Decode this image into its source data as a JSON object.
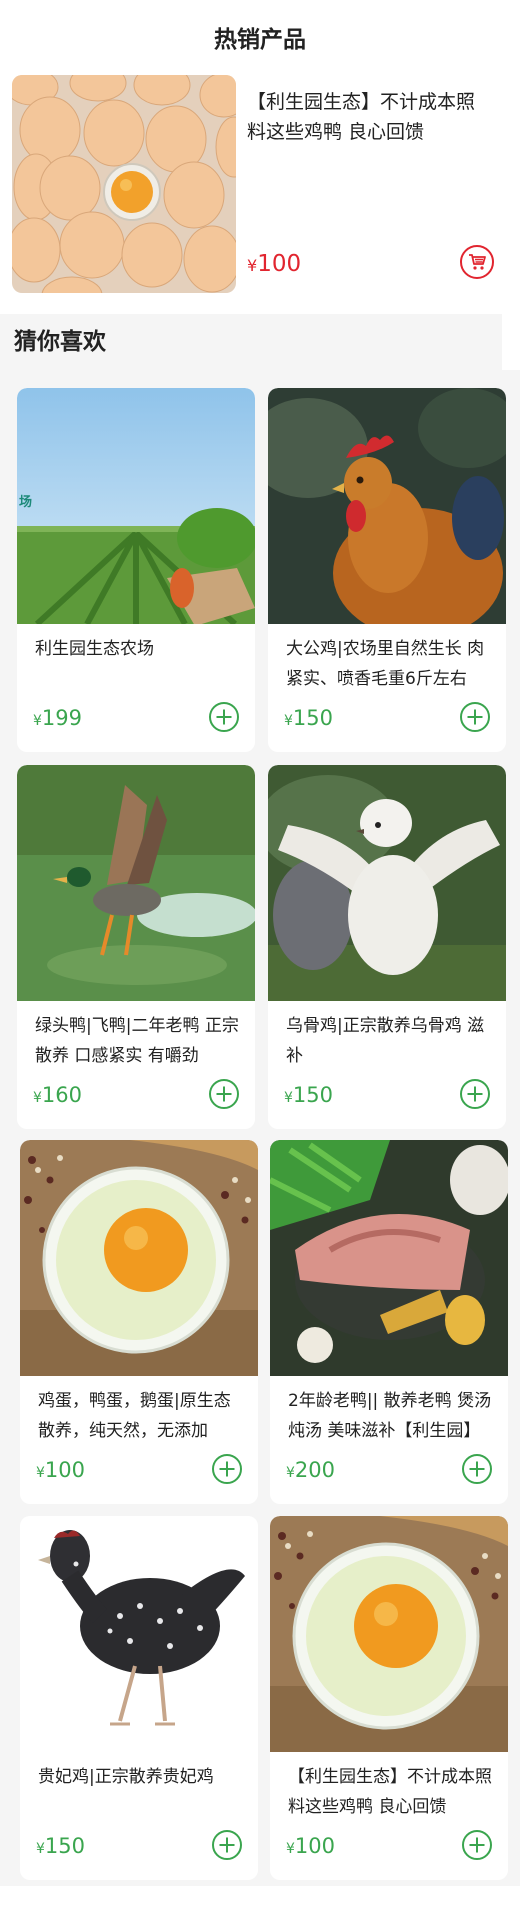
{
  "hot": {
    "title": "热销产品",
    "product": {
      "name": "【利生园生态】不计成本照料这些鸡鸭 良心回馈",
      "currency": "¥",
      "price": "100",
      "image_icon": "eggs-image"
    }
  },
  "guess": {
    "title": "猜你喜欢",
    "items": [
      {
        "name": "利生园生态农场",
        "currency": "¥",
        "price": "199",
        "image_icon": "farm-field-image",
        "image_text": "场"
      },
      {
        "name": "大公鸡|农场里自然生长 肉紧实、喷香毛重6斤左右",
        "currency": "¥",
        "price": "150",
        "image_icon": "rooster-image"
      },
      {
        "name": "绿头鸭|飞鸭|二年老鸭 正宗散养 口感紧实 有嚼劲",
        "currency": "¥",
        "price": "160",
        "image_icon": "flying-duck-image"
      },
      {
        "name": "乌骨鸡|正宗散养乌骨鸡 滋补",
        "currency": "¥",
        "price": "150",
        "image_icon": "silkie-chicken-image"
      },
      {
        "name": "鸡蛋，鸭蛋，鹅蛋|原生态散养，纯天然，无添加",
        "currency": "¥",
        "price": "100",
        "image_icon": "egg-yolk-bowl-image"
      },
      {
        "name": "2年龄老鸭|| 散养老鸭 煲汤炖汤 美味滋补【利生园】",
        "currency": "¥",
        "price": "200",
        "image_icon": "duck-meat-image"
      },
      {
        "name": "贵妃鸡|正宗散养贵妃鸡",
        "currency": "¥",
        "price": "150",
        "image_icon": "speckled-hen-image"
      },
      {
        "name": "【利生园生态】不计成本照料这些鸡鸭 良心回馈",
        "currency": "¥",
        "price": "100",
        "image_icon": "egg-yolk-bowl-image"
      }
    ]
  },
  "colors": {
    "price_red": "#e1252f",
    "price_green": "#3aa54e",
    "section_bg": "#f5f5f5"
  }
}
